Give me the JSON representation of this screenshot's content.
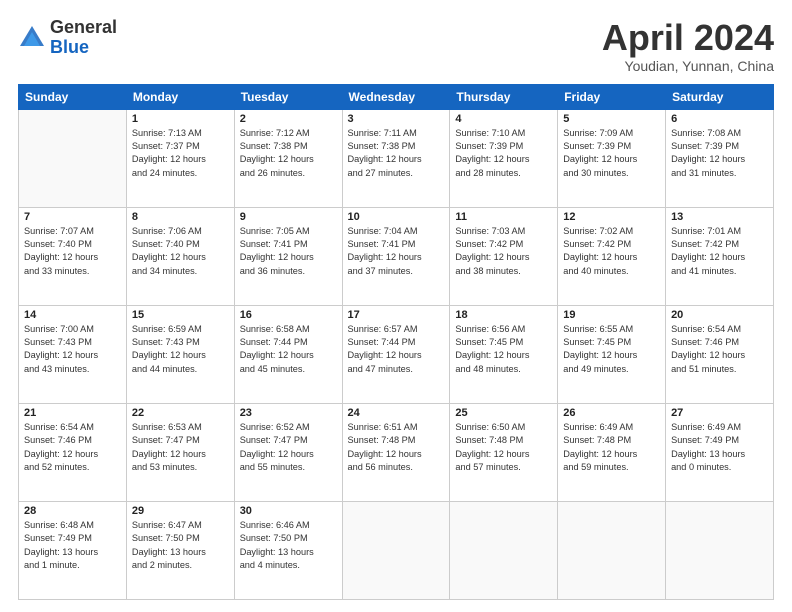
{
  "header": {
    "logo_general": "General",
    "logo_blue": "Blue",
    "month_title": "April 2024",
    "subtitle": "Youdian, Yunnan, China"
  },
  "weekdays": [
    "Sunday",
    "Monday",
    "Tuesday",
    "Wednesday",
    "Thursday",
    "Friday",
    "Saturday"
  ],
  "weeks": [
    [
      {
        "day": "",
        "info": ""
      },
      {
        "day": "1",
        "info": "Sunrise: 7:13 AM\nSunset: 7:37 PM\nDaylight: 12 hours\nand 24 minutes."
      },
      {
        "day": "2",
        "info": "Sunrise: 7:12 AM\nSunset: 7:38 PM\nDaylight: 12 hours\nand 26 minutes."
      },
      {
        "day": "3",
        "info": "Sunrise: 7:11 AM\nSunset: 7:38 PM\nDaylight: 12 hours\nand 27 minutes."
      },
      {
        "day": "4",
        "info": "Sunrise: 7:10 AM\nSunset: 7:39 PM\nDaylight: 12 hours\nand 28 minutes."
      },
      {
        "day": "5",
        "info": "Sunrise: 7:09 AM\nSunset: 7:39 PM\nDaylight: 12 hours\nand 30 minutes."
      },
      {
        "day": "6",
        "info": "Sunrise: 7:08 AM\nSunset: 7:39 PM\nDaylight: 12 hours\nand 31 minutes."
      }
    ],
    [
      {
        "day": "7",
        "info": "Sunrise: 7:07 AM\nSunset: 7:40 PM\nDaylight: 12 hours\nand 33 minutes."
      },
      {
        "day": "8",
        "info": "Sunrise: 7:06 AM\nSunset: 7:40 PM\nDaylight: 12 hours\nand 34 minutes."
      },
      {
        "day": "9",
        "info": "Sunrise: 7:05 AM\nSunset: 7:41 PM\nDaylight: 12 hours\nand 36 minutes."
      },
      {
        "day": "10",
        "info": "Sunrise: 7:04 AM\nSunset: 7:41 PM\nDaylight: 12 hours\nand 37 minutes."
      },
      {
        "day": "11",
        "info": "Sunrise: 7:03 AM\nSunset: 7:42 PM\nDaylight: 12 hours\nand 38 minutes."
      },
      {
        "day": "12",
        "info": "Sunrise: 7:02 AM\nSunset: 7:42 PM\nDaylight: 12 hours\nand 40 minutes."
      },
      {
        "day": "13",
        "info": "Sunrise: 7:01 AM\nSunset: 7:42 PM\nDaylight: 12 hours\nand 41 minutes."
      }
    ],
    [
      {
        "day": "14",
        "info": "Sunrise: 7:00 AM\nSunset: 7:43 PM\nDaylight: 12 hours\nand 43 minutes."
      },
      {
        "day": "15",
        "info": "Sunrise: 6:59 AM\nSunset: 7:43 PM\nDaylight: 12 hours\nand 44 minutes."
      },
      {
        "day": "16",
        "info": "Sunrise: 6:58 AM\nSunset: 7:44 PM\nDaylight: 12 hours\nand 45 minutes."
      },
      {
        "day": "17",
        "info": "Sunrise: 6:57 AM\nSunset: 7:44 PM\nDaylight: 12 hours\nand 47 minutes."
      },
      {
        "day": "18",
        "info": "Sunrise: 6:56 AM\nSunset: 7:45 PM\nDaylight: 12 hours\nand 48 minutes."
      },
      {
        "day": "19",
        "info": "Sunrise: 6:55 AM\nSunset: 7:45 PM\nDaylight: 12 hours\nand 49 minutes."
      },
      {
        "day": "20",
        "info": "Sunrise: 6:54 AM\nSunset: 7:46 PM\nDaylight: 12 hours\nand 51 minutes."
      }
    ],
    [
      {
        "day": "21",
        "info": "Sunrise: 6:54 AM\nSunset: 7:46 PM\nDaylight: 12 hours\nand 52 minutes."
      },
      {
        "day": "22",
        "info": "Sunrise: 6:53 AM\nSunset: 7:47 PM\nDaylight: 12 hours\nand 53 minutes."
      },
      {
        "day": "23",
        "info": "Sunrise: 6:52 AM\nSunset: 7:47 PM\nDaylight: 12 hours\nand 55 minutes."
      },
      {
        "day": "24",
        "info": "Sunrise: 6:51 AM\nSunset: 7:48 PM\nDaylight: 12 hours\nand 56 minutes."
      },
      {
        "day": "25",
        "info": "Sunrise: 6:50 AM\nSunset: 7:48 PM\nDaylight: 12 hours\nand 57 minutes."
      },
      {
        "day": "26",
        "info": "Sunrise: 6:49 AM\nSunset: 7:48 PM\nDaylight: 12 hours\nand 59 minutes."
      },
      {
        "day": "27",
        "info": "Sunrise: 6:49 AM\nSunset: 7:49 PM\nDaylight: 13 hours\nand 0 minutes."
      }
    ],
    [
      {
        "day": "28",
        "info": "Sunrise: 6:48 AM\nSunset: 7:49 PM\nDaylight: 13 hours\nand 1 minute."
      },
      {
        "day": "29",
        "info": "Sunrise: 6:47 AM\nSunset: 7:50 PM\nDaylight: 13 hours\nand 2 minutes."
      },
      {
        "day": "30",
        "info": "Sunrise: 6:46 AM\nSunset: 7:50 PM\nDaylight: 13 hours\nand 4 minutes."
      },
      {
        "day": "",
        "info": ""
      },
      {
        "day": "",
        "info": ""
      },
      {
        "day": "",
        "info": ""
      },
      {
        "day": "",
        "info": ""
      }
    ]
  ]
}
